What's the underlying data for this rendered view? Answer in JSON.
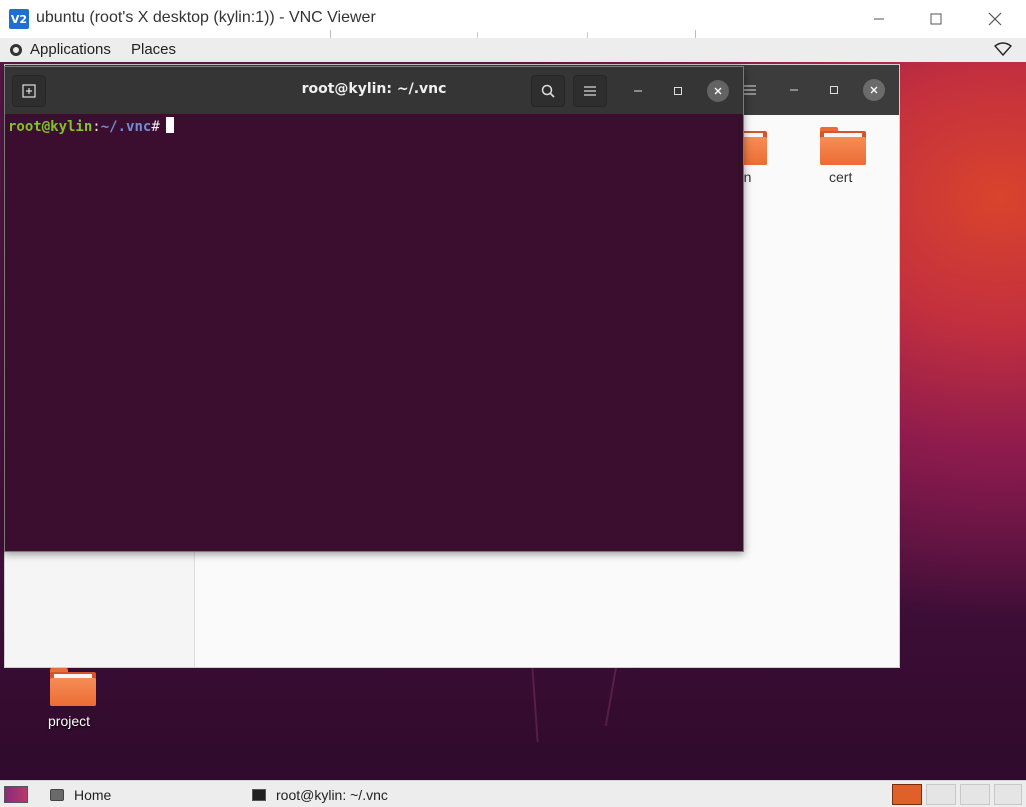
{
  "vnc": {
    "logo_text": "V2",
    "title": "ubuntu (root's X desktop (kylin:1)) - VNC Viewer"
  },
  "top_panel": {
    "applications": "Applications",
    "places": "Places"
  },
  "file_manager": {
    "folders": [
      {
        "label": "rn"
      },
      {
        "label": "cert"
      }
    ]
  },
  "terminal": {
    "title": "root@kylin: ~/.vnc",
    "prompt_user": "root@kylin",
    "prompt_colon": ":",
    "prompt_path": "~/.vnc",
    "prompt_symbol": "#"
  },
  "desktop": {
    "icons": [
      {
        "label": "project"
      }
    ]
  },
  "taskbar": {
    "items": [
      {
        "label": "Home"
      },
      {
        "label": "root@kylin: ~/.vnc"
      }
    ]
  },
  "colors": {
    "accent": "#e0602a",
    "terminal_bg": "#3b0d2e",
    "prompt_user": "#7fc42a",
    "prompt_path": "#6e8fd8"
  }
}
